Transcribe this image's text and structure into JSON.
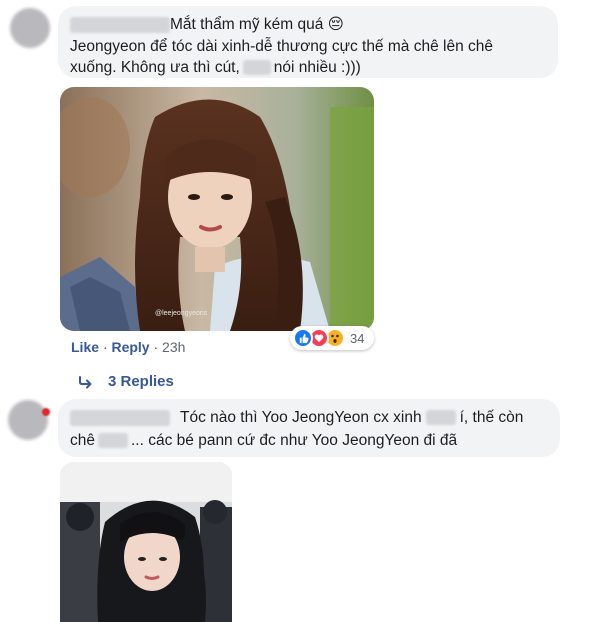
{
  "comment1": {
    "text": "Mắt thẩm mỹ kém quá 😔",
    "line2": "Jeongyeon để tóc dài xinh-dễ thương cực thế mà chê lên chê",
    "line3_before": "xuống. Không ưa thì cút,",
    "line3_after": "nói nhiều :)))",
    "actions": {
      "like": "Like",
      "reply": "Reply",
      "time": "23h"
    },
    "reaction_count": "34",
    "photo_watermark": "@leejeongyeons",
    "reaction_icons": [
      "like-icon",
      "love-icon",
      "wow-icon"
    ],
    "reaction_colors": {
      "like": "#1877f2",
      "love": "#f33e58",
      "wow": "#f7b125"
    }
  },
  "replies_link": {
    "label": "3 Replies",
    "icon": "reply-arrow-icon"
  },
  "comment2": {
    "line1_before": "Tóc nào thì Yoo JeongYeon cx xinh",
    "line1_after": "í, thế còn",
    "line2_before": "chê",
    "line2_after": "... các bé pann cứ đc như Yoo JeongYeon đi đã"
  },
  "colors": {
    "link": "#385898",
    "bubble": "#f2f3f5",
    "text": "#1c1e21"
  }
}
